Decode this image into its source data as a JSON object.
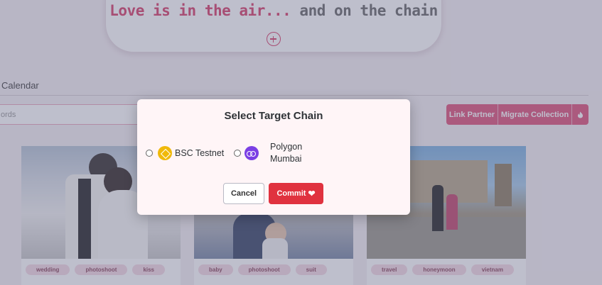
{
  "hero": {
    "title_part1": "Love is in the air...",
    "title_part2": " and on the chain",
    "add_icon": "plus-circle-icon"
  },
  "nav": {
    "tab_calendar": "Calendar"
  },
  "search": {
    "placeholder": "ords"
  },
  "actions": {
    "link_partner": "Link Partner",
    "migrate_collection": "Migrate Collection",
    "fire_icon": "fire-icon"
  },
  "cards": [
    {
      "tags": [
        "wedding",
        "photoshoot",
        "kiss"
      ]
    },
    {
      "tags": [
        "baby",
        "photoshoot",
        "suit"
      ]
    },
    {
      "tags": [
        "travel",
        "honeymoon",
        "vietnam"
      ]
    }
  ],
  "modal": {
    "title": "Select Target Chain",
    "options": [
      {
        "label": "BSC Testnet",
        "icon": "bnb-chain-icon"
      },
      {
        "label": "Polygon Mumbai",
        "icon": "polygon-icon"
      }
    ],
    "cancel_label": "Cancel",
    "commit_label": "Commit",
    "commit_icon": "heart-icon"
  },
  "colors": {
    "accent_pink": "#e0577e",
    "commit_red": "#e0323f",
    "bsc_yellow": "#f0b90b",
    "polygon_purple": "#7b3fe4"
  }
}
